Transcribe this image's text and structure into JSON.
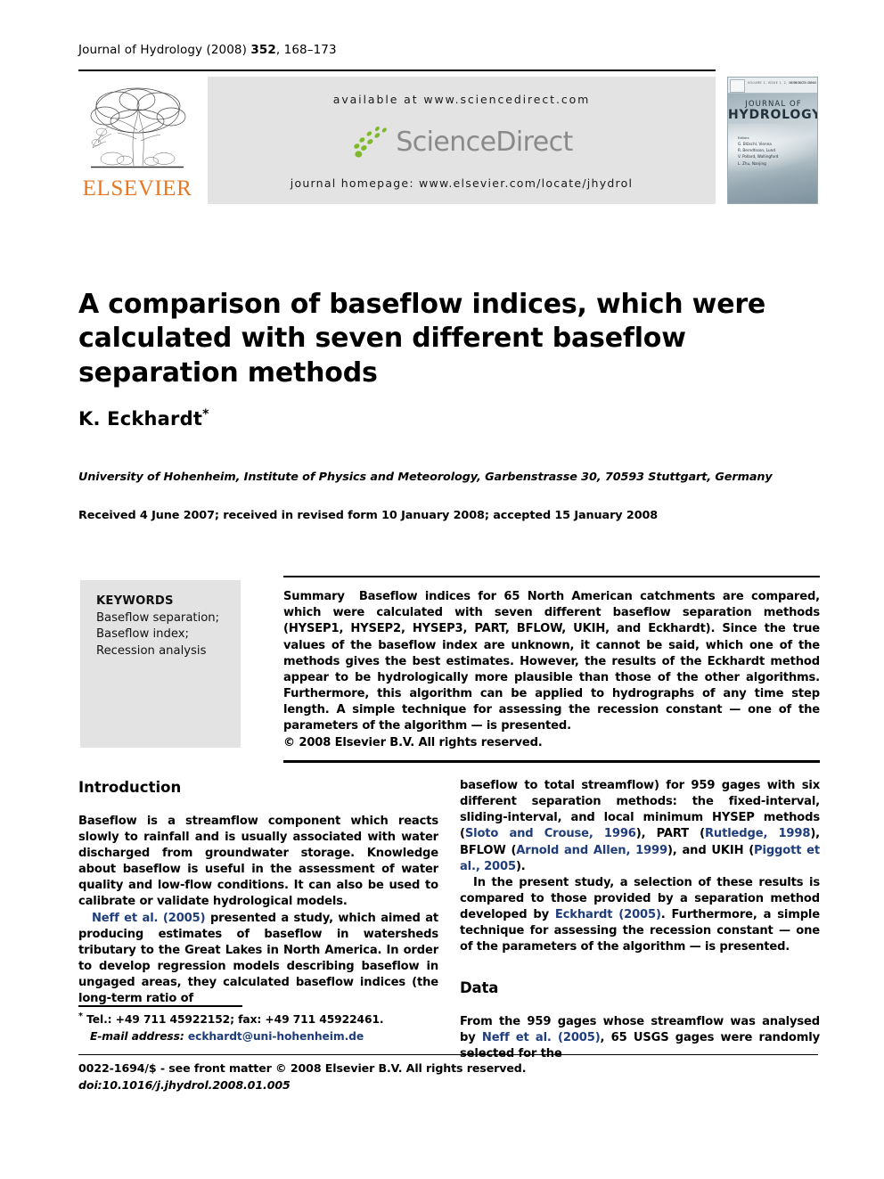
{
  "running_head": {
    "journal": "Journal of Hydrology",
    "year": "(2008)",
    "volume": "352",
    "pages": ", 168–173"
  },
  "masthead": {
    "publisher_name": "ELSEVIER",
    "available_at": "available at www.sciencedirect.com",
    "sciencedirect_name": "ScienceDirect",
    "journal_homepage": "journal homepage: www.elsevier.com/locate/jhydrol",
    "cover": {
      "top_left_label": "ELSEVIER",
      "top_bar_text": "VOLUME 1, ISSUE 1, 2, 00 MONTH 2008",
      "top_bar_text_right": "ISSN 0022-1694",
      "title_line1": "JOURNAL OF",
      "title_line2": "HYDROLOGY",
      "editors_heading": "Editors",
      "editors": [
        "G. Blöschl, Vienna",
        "R. Berndtsson, Lund",
        "V. Pollard, Wallingford",
        "L. Zhu, Nanjing"
      ]
    }
  },
  "article": {
    "title": "A comparison of baseflow indices, which were calculated with seven different baseflow separation methods",
    "author": "K. Eckhardt",
    "author_marker": "*",
    "affiliation": "University of Hohenheim, Institute of Physics and Meteorology, Garbenstrasse 30, 70593 Stuttgart, Germany",
    "history": "Received 4 June 2007; received in revised form 10 January 2008; accepted 15 January 2008"
  },
  "keywords": {
    "heading": "KEYWORDS",
    "items": [
      "Baseflow separation;",
      "Baseflow index;",
      "Recession analysis"
    ]
  },
  "summary": {
    "label": "Summary",
    "text": "Baseflow indices for 65 North American catchments are compared, which were calculated with seven different baseflow separation methods (HYSEP1, HYSEP2, HYSEP3, PART, BFLOW, UKIH, and Eckhardt). Since the true values of the baseflow index are unknown, it cannot be said, which one of the methods gives the best estimates. However, the results of the Eckhardt method appear to be hydrologically more plausible than those of the other algorithms. Furthermore, this algorithm can be applied to hydrographs of any time step length. A simple technique for assessing the recession constant — one of the parameters of the algorithm — is presented.",
    "copyright": "© 2008 Elsevier B.V. All rights reserved."
  },
  "body": {
    "intro_heading": "Introduction",
    "intro_p1": "Baseflow is a streamflow component which reacts slowly to rainfall and is usually associated with water discharged from groundwater storage. Knowledge about baseflow is useful in the assessment of water quality and low-flow conditions. It can also be used to calibrate or validate hydrological models.",
    "intro_p2_cite": "Neff et al. (2005)",
    "intro_p2_rest": " presented a study, which aimed at producing estimates of baseflow in watersheds tributary to the Great Lakes in North America. In order to develop regression models describing baseflow in ungaged areas, they calculated baseflow indices (the long-term ratio of",
    "right_p1_a": "baseflow to total streamflow) for 959 gages with six different separation methods: the fixed-interval, sliding-interval, and local minimum HYSEP methods (",
    "right_cite1": "Sloto and Crouse, 1996",
    "right_p1_b": "), PART (",
    "right_cite2": "Rutledge, 1998",
    "right_p1_c": "), BFLOW (",
    "right_cite3": "Arnold and Allen, 1999",
    "right_p1_d": "), and UKIH (",
    "right_cite4": "Piggott et al., 2005",
    "right_p1_e": ").",
    "right_p2_a": "In the present study, a selection of these results is compared to those provided by a separation method developed by ",
    "right_cite5": "Eckhardt (2005)",
    "right_p2_b": ". Furthermore, a simple technique for assessing the recession constant — one of the parameters of the algorithm — is presented.",
    "data_heading": "Data",
    "data_p1_a": "From the 959 gages whose streamflow was analysed by ",
    "data_cite1": "Neff et al. (2005)",
    "data_p1_b": ", 65 USGS gages were randomly selected for the"
  },
  "footnote": {
    "marker": "*",
    "tel_fax": "Tel.: +49 711 45922152; fax: +49 711 45922461.",
    "email_label": "E-mail address:",
    "email": "eckhardt@uni-hohenheim.de"
  },
  "imprint": {
    "line1": "0022-1694/$ - see front matter © 2008 Elsevier B.V. All rights reserved.",
    "doi": "doi:10.1016/j.jhydrol.2008.01.005"
  },
  "colors": {
    "link": "#1F3D7A",
    "elsevier_orange": "#E87722",
    "panel_grey": "#E3E3E3",
    "sciencedirect_green": "#7DB928",
    "sciencedirect_grey": "#8A8A8A"
  }
}
